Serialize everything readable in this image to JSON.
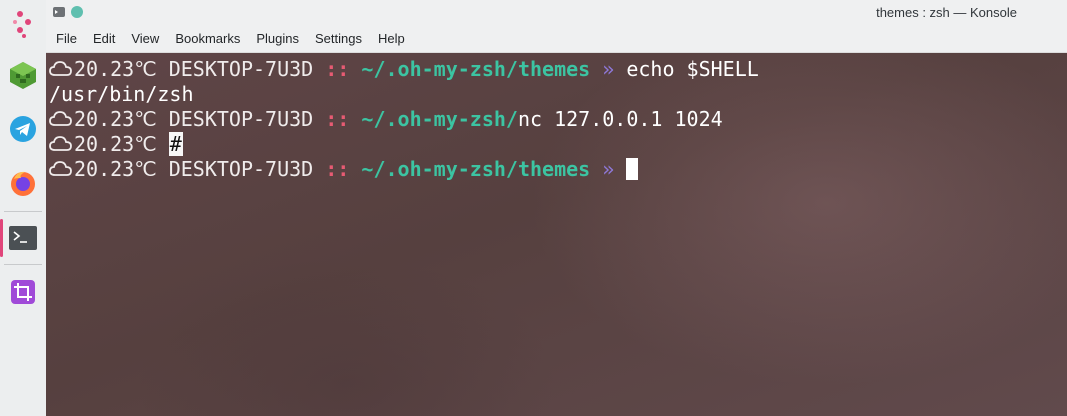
{
  "dock": {
    "items": [
      {
        "name": "app-launcher-icon",
        "color": "#e0457a"
      },
      {
        "name": "minecraft-icon",
        "color": "#5aa83a"
      },
      {
        "name": "telegram-icon",
        "color": "#2aa3e0"
      },
      {
        "name": "firefox-icon",
        "color": "#f2692a"
      },
      {
        "name": "konsole-icon",
        "color": "#4b5054"
      },
      {
        "name": "spectacle-crop-icon",
        "color": "#a04ad8"
      }
    ]
  },
  "window": {
    "title": "themes : zsh — Konsole"
  },
  "menubar": {
    "items": [
      "File",
      "Edit",
      "View",
      "Bookmarks",
      "Plugins",
      "Settings",
      "Help"
    ]
  },
  "terminal": {
    "lines": [
      {
        "temp": "20.23℃",
        "host": "DESKTOP-7U3D",
        "sep": "::",
        "path": "~/.oh-my-zsh/themes",
        "arrow": "»",
        "cmd": "echo $SHELL"
      },
      {
        "output": "/usr/bin/zsh"
      },
      {
        "temp": "20.23℃",
        "host": "DESKTOP-7U3D",
        "sep": "::",
        "path": "~/.oh-my-zsh/",
        "cmd": "nc 127.0.0.1 1024"
      },
      {
        "temp": "20.23℃",
        "hash": "#"
      },
      {
        "temp": "20.23℃",
        "host": "DESKTOP-7U3D",
        "sep": "::",
        "path": "~/.oh-my-zsh/themes",
        "arrow": "»"
      }
    ]
  },
  "colors": {
    "separator": "#e75b73",
    "path": "#3cc4a2",
    "arrow": "#8e78d8",
    "text": "#f0ecec"
  }
}
